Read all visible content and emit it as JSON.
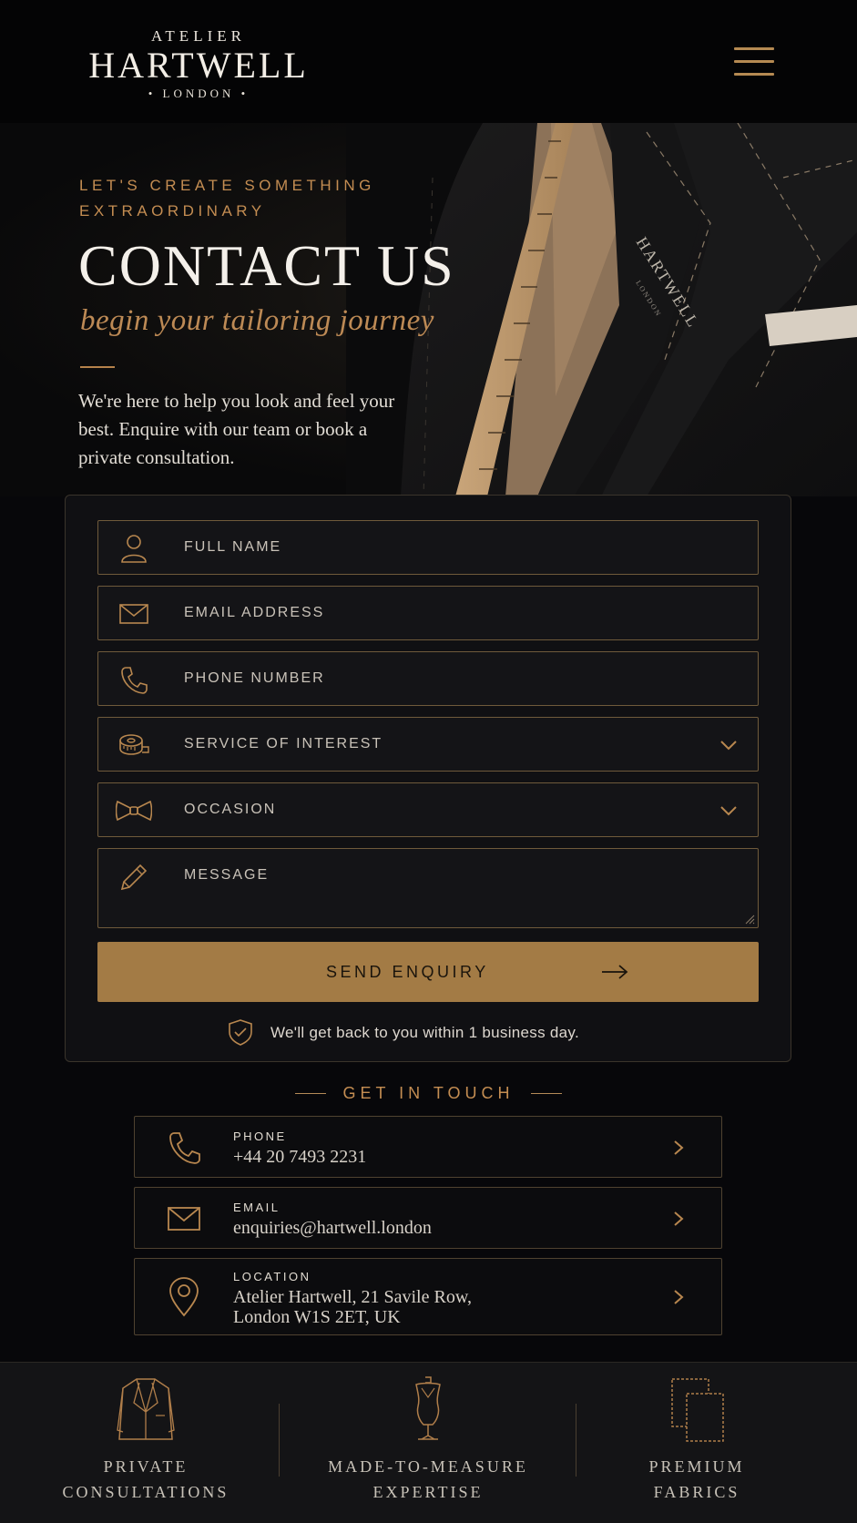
{
  "brand": {
    "top": "ATELIER",
    "name": "HARTWELL",
    "city": "• LONDON •"
  },
  "hero": {
    "eyebrow": "LET'S CREATE SOMETHING EXTRAORDINARY",
    "title": "CONTACT US",
    "subtitle": "begin your tailoring journey",
    "intro": "We're here to help you look and feel your best. Enquire with our team or book a private consultation.",
    "image_label": "HARTWELL",
    "image_sub": "LONDON"
  },
  "form": {
    "fields": [
      {
        "placeholder": "FULL NAME",
        "icon": "user-icon"
      },
      {
        "placeholder": "EMAIL ADDRESS",
        "icon": "envelope-icon"
      },
      {
        "placeholder": "PHONE NUMBER",
        "icon": "phone-icon"
      },
      {
        "placeholder": "SERVICE OF INTEREST",
        "icon": "tape-measure-icon"
      },
      {
        "placeholder": "OCCASION",
        "icon": "bow-tie-icon"
      },
      {
        "placeholder": "MESSAGE",
        "icon": "pencil-icon"
      }
    ],
    "submit": "SEND ENQUIRY",
    "note": "We'll get back to you within 1 business day."
  },
  "contact": {
    "heading": "GET IN TOUCH",
    "items": [
      {
        "key": "PHONE",
        "value": "+44 20 7493 2231",
        "icon": "phone-icon"
      },
      {
        "key": "EMAIL",
        "value": "enquiries@hartwell.london",
        "icon": "envelope-icon"
      },
      {
        "key": "LOCATION",
        "value_line1": "Atelier Hartwell, 21 Savile Row,",
        "value_line2": "London W1S 2ET, UK",
        "icon": "map-pin-icon"
      }
    ]
  },
  "features": [
    {
      "line1": "PRIVATE",
      "line2": "CONSULTATIONS",
      "icon": "jacket-icon"
    },
    {
      "line1": "MADE-TO-MEASURE",
      "line2": "EXPERTISE",
      "icon": "mannequin-icon"
    },
    {
      "line1": "PREMIUM",
      "line2": "FABRICS",
      "icon": "fabric-swatch-icon"
    }
  ],
  "colors": {
    "accent": "#a37b45",
    "gold_text": "#c48d52",
    "background": "#07070a"
  }
}
